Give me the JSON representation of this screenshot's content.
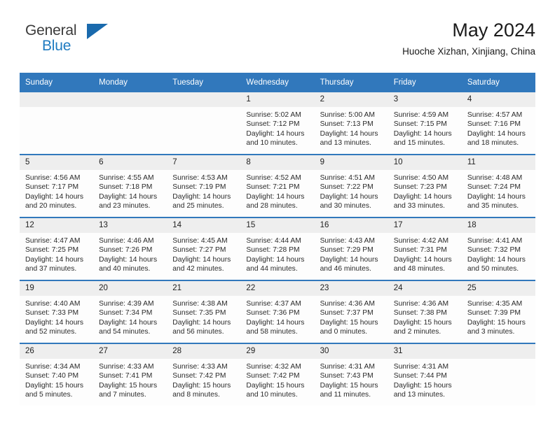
{
  "brand": {
    "name_top": "General",
    "name_bottom": "Blue",
    "triangle_icon": "triangle-icon",
    "accent_color": "#1f7bc1"
  },
  "header": {
    "month_title": "May 2024",
    "location": "Huoche Xizhan, Xinjiang, China"
  },
  "colors": {
    "header_blue": "#3178bc",
    "daynum_band": "#eeeeee",
    "cell_background": "#fdfdfd",
    "text": "#2a2a2a"
  },
  "weekday_headers": [
    "Sunday",
    "Monday",
    "Tuesday",
    "Wednesday",
    "Thursday",
    "Friday",
    "Saturday"
  ],
  "weeks": [
    [
      {
        "day": "",
        "empty": true,
        "lines": []
      },
      {
        "day": "",
        "empty": true,
        "lines": []
      },
      {
        "day": "",
        "empty": true,
        "lines": []
      },
      {
        "day": "1",
        "empty": false,
        "lines": [
          "Sunrise: 5:02 AM",
          "Sunset: 7:12 PM",
          "Daylight: 14 hours",
          "and 10 minutes."
        ]
      },
      {
        "day": "2",
        "empty": false,
        "lines": [
          "Sunrise: 5:00 AM",
          "Sunset: 7:13 PM",
          "Daylight: 14 hours",
          "and 13 minutes."
        ]
      },
      {
        "day": "3",
        "empty": false,
        "lines": [
          "Sunrise: 4:59 AM",
          "Sunset: 7:15 PM",
          "Daylight: 14 hours",
          "and 15 minutes."
        ]
      },
      {
        "day": "4",
        "empty": false,
        "lines": [
          "Sunrise: 4:57 AM",
          "Sunset: 7:16 PM",
          "Daylight: 14 hours",
          "and 18 minutes."
        ]
      }
    ],
    [
      {
        "day": "5",
        "empty": false,
        "lines": [
          "Sunrise: 4:56 AM",
          "Sunset: 7:17 PM",
          "Daylight: 14 hours",
          "and 20 minutes."
        ]
      },
      {
        "day": "6",
        "empty": false,
        "lines": [
          "Sunrise: 4:55 AM",
          "Sunset: 7:18 PM",
          "Daylight: 14 hours",
          "and 23 minutes."
        ]
      },
      {
        "day": "7",
        "empty": false,
        "lines": [
          "Sunrise: 4:53 AM",
          "Sunset: 7:19 PM",
          "Daylight: 14 hours",
          "and 25 minutes."
        ]
      },
      {
        "day": "8",
        "empty": false,
        "lines": [
          "Sunrise: 4:52 AM",
          "Sunset: 7:21 PM",
          "Daylight: 14 hours",
          "and 28 minutes."
        ]
      },
      {
        "day": "9",
        "empty": false,
        "lines": [
          "Sunrise: 4:51 AM",
          "Sunset: 7:22 PM",
          "Daylight: 14 hours",
          "and 30 minutes."
        ]
      },
      {
        "day": "10",
        "empty": false,
        "lines": [
          "Sunrise: 4:50 AM",
          "Sunset: 7:23 PM",
          "Daylight: 14 hours",
          "and 33 minutes."
        ]
      },
      {
        "day": "11",
        "empty": false,
        "lines": [
          "Sunrise: 4:48 AM",
          "Sunset: 7:24 PM",
          "Daylight: 14 hours",
          "and 35 minutes."
        ]
      }
    ],
    [
      {
        "day": "12",
        "empty": false,
        "lines": [
          "Sunrise: 4:47 AM",
          "Sunset: 7:25 PM",
          "Daylight: 14 hours",
          "and 37 minutes."
        ]
      },
      {
        "day": "13",
        "empty": false,
        "lines": [
          "Sunrise: 4:46 AM",
          "Sunset: 7:26 PM",
          "Daylight: 14 hours",
          "and 40 minutes."
        ]
      },
      {
        "day": "14",
        "empty": false,
        "lines": [
          "Sunrise: 4:45 AM",
          "Sunset: 7:27 PM",
          "Daylight: 14 hours",
          "and 42 minutes."
        ]
      },
      {
        "day": "15",
        "empty": false,
        "lines": [
          "Sunrise: 4:44 AM",
          "Sunset: 7:28 PM",
          "Daylight: 14 hours",
          "and 44 minutes."
        ]
      },
      {
        "day": "16",
        "empty": false,
        "lines": [
          "Sunrise: 4:43 AM",
          "Sunset: 7:29 PM",
          "Daylight: 14 hours",
          "and 46 minutes."
        ]
      },
      {
        "day": "17",
        "empty": false,
        "lines": [
          "Sunrise: 4:42 AM",
          "Sunset: 7:31 PM",
          "Daylight: 14 hours",
          "and 48 minutes."
        ]
      },
      {
        "day": "18",
        "empty": false,
        "lines": [
          "Sunrise: 4:41 AM",
          "Sunset: 7:32 PM",
          "Daylight: 14 hours",
          "and 50 minutes."
        ]
      }
    ],
    [
      {
        "day": "19",
        "empty": false,
        "lines": [
          "Sunrise: 4:40 AM",
          "Sunset: 7:33 PM",
          "Daylight: 14 hours",
          "and 52 minutes."
        ]
      },
      {
        "day": "20",
        "empty": false,
        "lines": [
          "Sunrise: 4:39 AM",
          "Sunset: 7:34 PM",
          "Daylight: 14 hours",
          "and 54 minutes."
        ]
      },
      {
        "day": "21",
        "empty": false,
        "lines": [
          "Sunrise: 4:38 AM",
          "Sunset: 7:35 PM",
          "Daylight: 14 hours",
          "and 56 minutes."
        ]
      },
      {
        "day": "22",
        "empty": false,
        "lines": [
          "Sunrise: 4:37 AM",
          "Sunset: 7:36 PM",
          "Daylight: 14 hours",
          "and 58 minutes."
        ]
      },
      {
        "day": "23",
        "empty": false,
        "lines": [
          "Sunrise: 4:36 AM",
          "Sunset: 7:37 PM",
          "Daylight: 15 hours",
          "and 0 minutes."
        ]
      },
      {
        "day": "24",
        "empty": false,
        "lines": [
          "Sunrise: 4:36 AM",
          "Sunset: 7:38 PM",
          "Daylight: 15 hours",
          "and 2 minutes."
        ]
      },
      {
        "day": "25",
        "empty": false,
        "lines": [
          "Sunrise: 4:35 AM",
          "Sunset: 7:39 PM",
          "Daylight: 15 hours",
          "and 3 minutes."
        ]
      }
    ],
    [
      {
        "day": "26",
        "empty": false,
        "lines": [
          "Sunrise: 4:34 AM",
          "Sunset: 7:40 PM",
          "Daylight: 15 hours",
          "and 5 minutes."
        ]
      },
      {
        "day": "27",
        "empty": false,
        "lines": [
          "Sunrise: 4:33 AM",
          "Sunset: 7:41 PM",
          "Daylight: 15 hours",
          "and 7 minutes."
        ]
      },
      {
        "day": "28",
        "empty": false,
        "lines": [
          "Sunrise: 4:33 AM",
          "Sunset: 7:42 PM",
          "Daylight: 15 hours",
          "and 8 minutes."
        ]
      },
      {
        "day": "29",
        "empty": false,
        "lines": [
          "Sunrise: 4:32 AM",
          "Sunset: 7:42 PM",
          "Daylight: 15 hours",
          "and 10 minutes."
        ]
      },
      {
        "day": "30",
        "empty": false,
        "lines": [
          "Sunrise: 4:31 AM",
          "Sunset: 7:43 PM",
          "Daylight: 15 hours",
          "and 11 minutes."
        ]
      },
      {
        "day": "31",
        "empty": false,
        "lines": [
          "Sunrise: 4:31 AM",
          "Sunset: 7:44 PM",
          "Daylight: 15 hours",
          "and 13 minutes."
        ]
      },
      {
        "day": "",
        "empty": true,
        "lines": []
      }
    ]
  ]
}
